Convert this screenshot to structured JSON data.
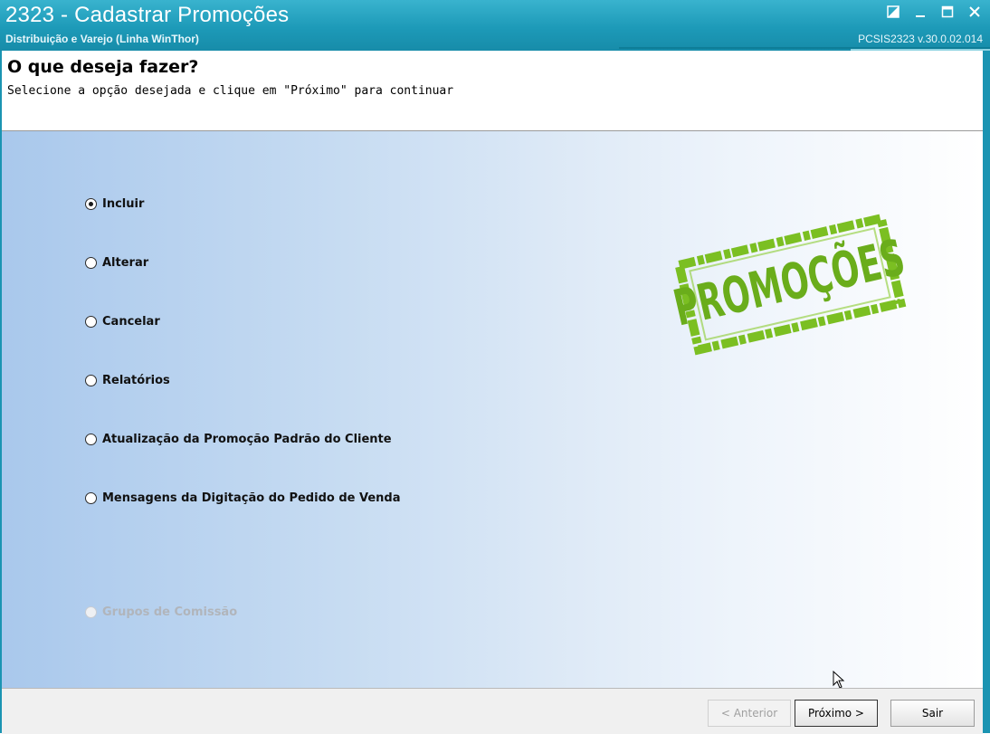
{
  "window": {
    "title": "2323 - Cadastrar Promoções",
    "subtitle": "Distribuição e Varejo (Linha WinThor)",
    "version": "PCSIS2323  v.30.0.02.014",
    "buttons": [
      "restore-icon",
      "minimize-icon",
      "maximize-icon",
      "close-icon"
    ]
  },
  "header": {
    "title": "O que deseja fazer?",
    "description": "Selecione a opção desejada e clique em \"Próximo\" para continuar"
  },
  "options": [
    {
      "label": "Incluir",
      "selected": true,
      "enabled": true
    },
    {
      "label": "Alterar",
      "selected": false,
      "enabled": true
    },
    {
      "label": "Cancelar",
      "selected": false,
      "enabled": true
    },
    {
      "label": "Relatórios",
      "selected": false,
      "enabled": true
    },
    {
      "label": "Atualização da Promoção Padrão do Cliente",
      "selected": false,
      "enabled": true
    },
    {
      "label": "Mensagens da Digitação do Pedido de Venda",
      "selected": false,
      "enabled": true
    },
    {
      "label": "Grupos de Comissão",
      "selected": false,
      "enabled": false
    }
  ],
  "stamp": {
    "text": "PROMOÇÕES",
    "color": "#7bbf22"
  },
  "footer": {
    "prev_label": "< Anterior",
    "next_label": "Próximo >",
    "exit_label": "Sair",
    "prev_enabled": false
  },
  "colors": {
    "titlebar": "#1d9ab8",
    "stamp_green": "#7bbf22"
  }
}
